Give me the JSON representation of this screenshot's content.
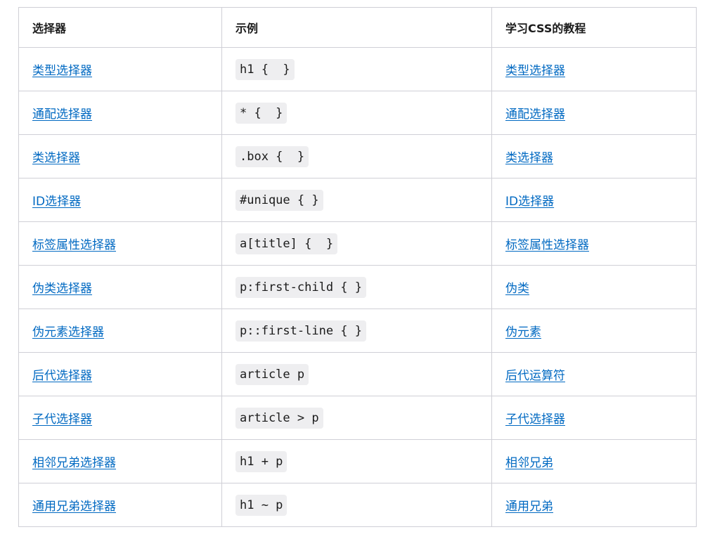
{
  "table": {
    "headers": [
      "选择器",
      "示例",
      "学习CSS的教程"
    ],
    "rows": [
      {
        "selector": "类型选择器",
        "example": "h1 {  }",
        "tutorial": "类型选择器"
      },
      {
        "selector": "通配选择器",
        "example": "* {  }",
        "tutorial": "通配选择器"
      },
      {
        "selector": "类选择器",
        "example": ".box {  }",
        "tutorial": "类选择器"
      },
      {
        "selector": "ID选择器",
        "example": "#unique { }",
        "tutorial": "ID选择器"
      },
      {
        "selector": "标签属性选择器",
        "example": "a[title] {  }",
        "tutorial": "标签属性选择器"
      },
      {
        "selector": "伪类选择器",
        "example": "p:first-child { }",
        "tutorial": "伪类"
      },
      {
        "selector": "伪元素选择器",
        "example": "p::first-line { }",
        "tutorial": "伪元素"
      },
      {
        "selector": "后代选择器",
        "example": "article p",
        "tutorial": "后代运算符"
      },
      {
        "selector": "子代选择器",
        "example": "article > p",
        "tutorial": "子代选择器"
      },
      {
        "selector": "相邻兄弟选择器",
        "example": "h1 + p",
        "tutorial": "相邻兄弟"
      },
      {
        "selector": "通用兄弟选择器",
        "example": "h1 ~ p",
        "tutorial": "通用兄弟"
      }
    ]
  },
  "colors": {
    "link": "#0069c2",
    "border": "#cfcfd6",
    "code_bg": "#eeeef0"
  }
}
